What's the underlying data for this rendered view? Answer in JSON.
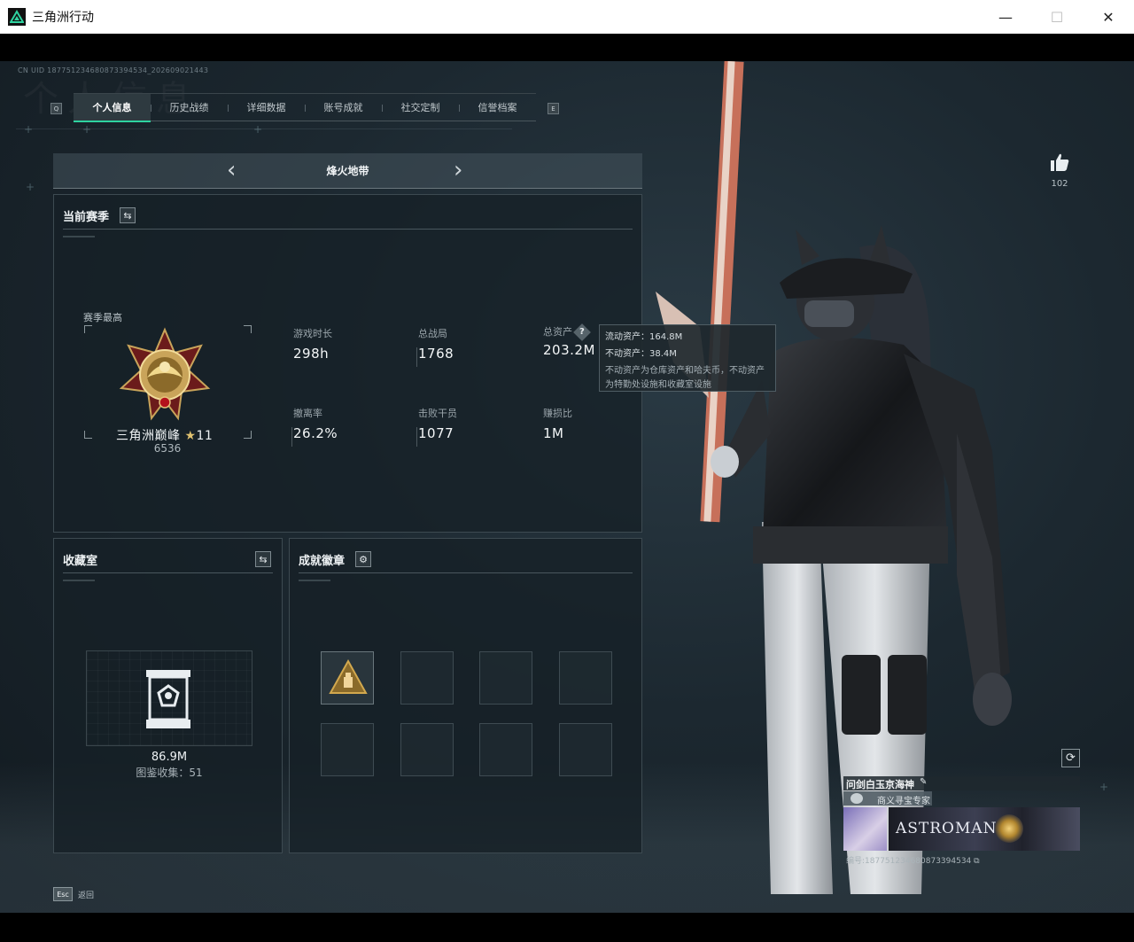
{
  "window": {
    "title": "三角洲行动",
    "minimize": "—",
    "maximize": "☐",
    "close": "✕"
  },
  "header": {
    "uid": "CN UID 187751234680873394534_202609021443",
    "watermark": "个人信息",
    "tab_key_left": "Q",
    "tab_key_right": "E"
  },
  "tabs": [
    {
      "label": "个人信息",
      "active": true
    },
    {
      "label": "历史战绩",
      "active": false
    },
    {
      "label": "详细数据",
      "active": false
    },
    {
      "label": "账号成就",
      "active": false
    },
    {
      "label": "社交定制",
      "active": false
    },
    {
      "label": "信誉档案",
      "active": false
    }
  ],
  "mode": {
    "title": "烽火地带",
    "prev": "‹",
    "next": "›"
  },
  "season": {
    "title": "当前赛季",
    "best_label": "赛季最高",
    "rank_name": "三角洲巅峰",
    "rank_star": "★",
    "rank_level": "11",
    "rank_points": "6536",
    "stats": [
      {
        "label": "游戏时长",
        "value": "298h"
      },
      {
        "label": "总战局",
        "value": "1768"
      },
      {
        "label": "总资产",
        "value": "203.2M"
      },
      {
        "label": "撤离率",
        "value": "26.2%"
      },
      {
        "label": "击败干员",
        "value": "1077"
      },
      {
        "label": "赚损比",
        "value": "1M"
      }
    ],
    "help": "?"
  },
  "tooltip": {
    "liquid": "流动资产：164.8M",
    "fixed": "不动资产：38.4M",
    "note": "不动资产为仓库资产和哈夫币，不动资产为特勤处设施和收藏室设施"
  },
  "collection": {
    "title": "收藏室",
    "value": "86.9M",
    "count_label": "图鉴收集：51"
  },
  "badges": {
    "title": "成就徽章",
    "slots": 8,
    "filled": 1
  },
  "profile": {
    "likes": "102",
    "name": "问剑白玉京海神",
    "edit": "✎",
    "title": "商义寻宝专家",
    "banner": "ASTROMANCY",
    "id": "编号:187751234680873394534"
  },
  "footer": {
    "esc_key": "Esc",
    "esc_label": "返回"
  },
  "colors": {
    "accent": "#2fd3a0",
    "panel_bg": "#16202699",
    "gold": "#e0c270"
  }
}
